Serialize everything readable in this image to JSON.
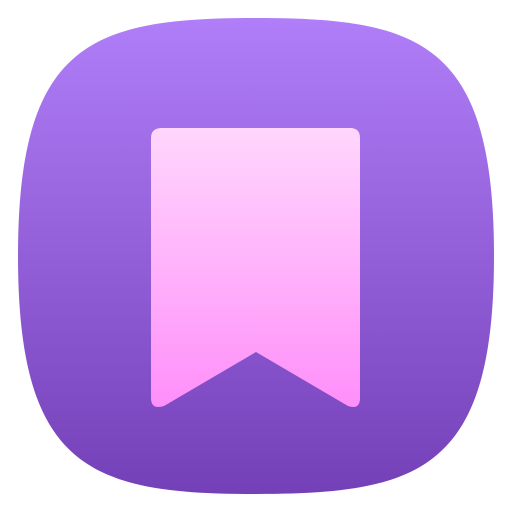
{
  "app_icon": {
    "icon": "bookmark-icon",
    "colors": {
      "tile_top": "#b07ef8",
      "tile_bottom": "#7440b8",
      "ribbon_top": "#ffd6fc",
      "ribbon_bottom": "#ff8ffa"
    }
  }
}
